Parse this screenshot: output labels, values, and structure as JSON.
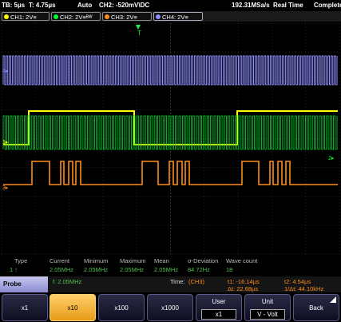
{
  "status": {
    "timebase": "TB: 5µs",
    "trig_offset": "T: 4.75µs",
    "mode": "Auto",
    "trigger": "CH2: -520mV\\DC",
    "sample_rate": "192.31MSa/s",
    "acq": "Real Time",
    "state": "Complete"
  },
  "channels": [
    {
      "label": "CH1: 2V≡",
      "color": "#ffff00"
    },
    {
      "label": "CH2: 2V≡ᴮᵂ",
      "color": "#00ff33"
    },
    {
      "label": "CH3: 2V≡",
      "color": "#ff8c1a"
    },
    {
      "label": "CH4: 2V≡",
      "color": "#8f8fff"
    }
  ],
  "markers": {
    "trig": "T",
    "ch1": "1▸",
    "ch2": "2▸",
    "ch3": "3▸",
    "ch4": "4▸"
  },
  "measurements": {
    "headers": [
      "Type",
      "Current",
      "Minimum",
      "Maximum",
      "Mean",
      "σ-Deviation",
      "Wave count"
    ],
    "values": [
      "1 ↑",
      "2.05MHz",
      "2.05MHz",
      "2.05MHz",
      "2.05MHz",
      "84.72Hz",
      "18"
    ]
  },
  "info": {
    "probe": "Probe",
    "freq": "f: 2.05MHz",
    "time_label": "Time:",
    "time_ch": "(CH3)",
    "t1": "t1: -16.14µs",
    "t2": "t2: 4.54µs",
    "dt": "Δt: 22.68µs",
    "inv_dt": "1/Δt: 44.10kHz"
  },
  "softkeys": {
    "k1": "x1",
    "k2": "x10",
    "k3": "x100",
    "k4": "x1000",
    "k5_top": "User",
    "k5_sub": "x1",
    "k6_top": "Unit",
    "k6_sub": "V - Volt",
    "k7": "Back"
  }
}
